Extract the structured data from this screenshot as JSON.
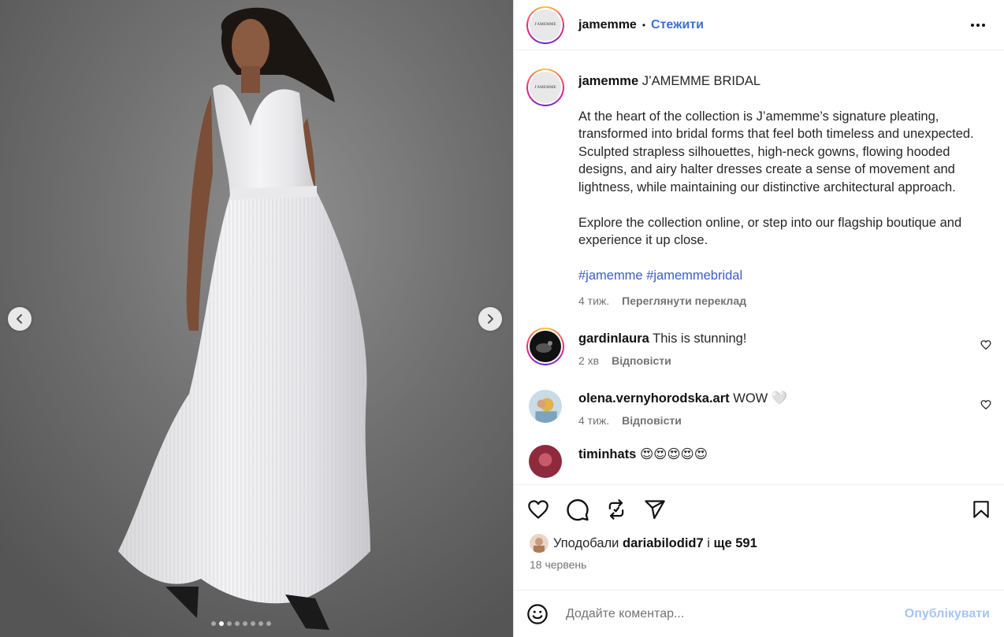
{
  "post": {
    "username": "jamemme",
    "avatar_text": "J'AMEMME",
    "follow_label": "Стежити",
    "more_icon": "more-dots-icon"
  },
  "caption": {
    "username": "jamemme",
    "title": "J’AMEMME BRIDAL",
    "paragraph1": "At the heart of the collection is J’amemme’s signature pleating, transformed into bridal forms that feel both timeless and unexpected. Sculpted strapless silhouettes, high-neck gowns, flowing hooded designs, and airy halter dresses create a sense of movement and lightness, while maintaining our distinctive architectural approach.",
    "paragraph2": "Explore the collection online, or step into our flagship boutique and experience it up close.",
    "hashtags": "#jamemme #jamemmebridal",
    "time": "4 тиж.",
    "translate_label": "Переглянути переклад"
  },
  "comments": [
    {
      "username": "gardinlaura",
      "text": "This is stunning!",
      "time": "2 хв",
      "reply_label": "Відповісти"
    },
    {
      "username": "olena.vernyhorodska.art",
      "text": "WOW 🤍",
      "time": "4 тиж.",
      "reply_label": "Відповісти"
    },
    {
      "username": "timinhats",
      "text": "😍😍😍😍😍"
    }
  ],
  "carousel": {
    "total_slides": 8,
    "active_index": 1
  },
  "likes": {
    "prefix": "Уподобали",
    "user": "dariabilodid7",
    "connector": "і",
    "more": "ще 591"
  },
  "date": "18 червень",
  "comment_box": {
    "placeholder": "Додайте коментар...",
    "publish_label": "Опублікувати"
  },
  "colors": {
    "follow_link": "#3b6fd6",
    "hashtag": "#3b5cc7",
    "publish_disabled": "#a7c4f5"
  }
}
